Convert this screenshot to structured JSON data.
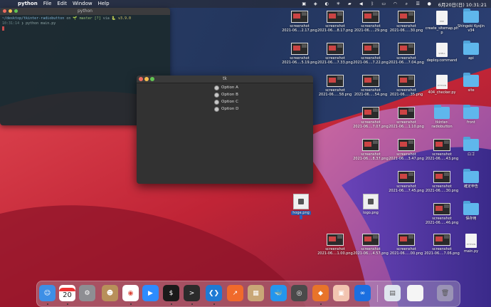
{
  "menubar": {
    "app_name": "python",
    "items": [
      "File",
      "Edit",
      "Window",
      "Help"
    ],
    "clock": "6月20日(日)  10:31:21"
  },
  "terminal": {
    "title": "python",
    "line1_path": "~/desktop/tkinter-radiobutton",
    "line1_on": " on ",
    "line1_git": "🌱 master [?]",
    "line1_via": " via ",
    "line1_py": "🐍 v3.9.0",
    "line2_time": "10:31:14",
    "line2_cmd": " ❯ python main.py"
  },
  "tk": {
    "title": "tk",
    "options": [
      "Option A",
      "Option B",
      "Option C",
      "Option D"
    ]
  },
  "desktop_icons": [
    {
      "label1": "screenshot",
      "label2": "2021-06....2.17.png",
      "kind": "shot"
    },
    {
      "label1": "screenshot",
      "label2": "2021-06....8.17.png",
      "kind": "shot"
    },
    {
      "label1": "screenshot",
      "label2": "2021-06.....29.png",
      "kind": "shot"
    },
    {
      "label1": "screenshot",
      "label2": "2021-06.....30.png",
      "kind": "shot"
    },
    {
      "label1": "create_sitemap.ph",
      "label2": "p",
      "kind": "doc",
      "tag": "PHP"
    },
    {
      "label1": "Shingeki Kyojin",
      "label2": "v34",
      "kind": "folder"
    },
    {
      "label1": "screenshot",
      "label2": "2021-06....5.19.png",
      "kind": "shot"
    },
    {
      "label1": "screenshot",
      "label2": "2021-06....7.33.png",
      "kind": "shot"
    },
    {
      "label1": "screenshot",
      "label2": "2021-06....7.22.png",
      "kind": "shot"
    },
    {
      "label1": "screenshot",
      "label2": "2021-06....7.04.png",
      "kind": "shot"
    },
    {
      "label1": "deploy.command",
      "label2": "",
      "kind": "doc",
      "tag": "SHELL"
    },
    {
      "label1": "api",
      "label2": "",
      "kind": "folder"
    },
    {
      "label1": "screenshot",
      "label2": "2021-06.....58.png",
      "kind": "shot"
    },
    {
      "label1": "screenshot",
      "label2": "2021-06.....54.png",
      "kind": "shot"
    },
    {
      "label1": "screenshot",
      "label2": "2021-06.....35.png",
      "kind": "shot"
    },
    {
      "label1": "404_checker.py",
      "label2": "",
      "kind": "doc",
      "tag": "PYTHON"
    },
    {
      "label1": "site",
      "label2": "",
      "kind": "folder"
    },
    {
      "label1": "screenshot",
      "label2": "2021-06....7.07.png",
      "kind": "shot"
    },
    {
      "label1": "screenshot",
      "label2": "2021-06....1.10.png",
      "kind": "shot"
    },
    {
      "label1": "tkinter-",
      "label2": "radiobutton",
      "kind": "folder"
    },
    {
      "label1": "front",
      "label2": "",
      "kind": "folder"
    },
    {
      "label1": "screenshot",
      "label2": "2021-06....8.37.png",
      "kind": "shot"
    },
    {
      "label1": "screenshot",
      "label2": "2021-06....3.47.png",
      "kind": "shot"
    },
    {
      "label1": "screenshot",
      "label2": "2021-06.....43.png",
      "kind": "shot"
    },
    {
      "label1": "ロゴ",
      "label2": "",
      "kind": "folder"
    },
    {
      "label1": "screenshot",
      "label2": "2021-06....7.45.png",
      "kind": "shot"
    },
    {
      "label1": "screenshot",
      "label2": "2021-06.....30.png",
      "kind": "shot"
    },
    {
      "label1": "確定申告",
      "label2": "",
      "kind": "folder"
    },
    {
      "label1": "hoge.png",
      "label2": "",
      "kind": "img",
      "selected": true
    },
    {
      "label1": "logo.png",
      "label2": "",
      "kind": "img"
    },
    {
      "label1": "screenshot",
      "label2": "2021-06.....46.png",
      "kind": "shot"
    },
    {
      "label1": "保存用",
      "label2": "",
      "kind": "folder"
    },
    {
      "label1": "screenshot",
      "label2": "2021-06....1.00.png",
      "kind": "shot"
    },
    {
      "label1": "screenshot",
      "label2": "2021-06....4.57.png",
      "kind": "shot"
    },
    {
      "label1": "screenshot",
      "label2": "2021-06.....00.png",
      "kind": "shot"
    },
    {
      "label1": "screenshot",
      "label2": "2021-06....7.06.png",
      "kind": "shot"
    },
    {
      "label1": "main.py",
      "label2": "",
      "kind": "doc",
      "tag": "PYTHON"
    }
  ],
  "dock": {
    "calendar_day": "20",
    "apps": [
      {
        "name": "finder-icon",
        "color": "#3d8fe6",
        "glyph": "☺"
      },
      {
        "name": "calendar-icon",
        "color": "#ffffff",
        "glyph": ""
      },
      {
        "name": "system-preferences-icon",
        "color": "#8e8e93",
        "glyph": "⚙"
      },
      {
        "name": "contacts-icon",
        "color": "#b8905a",
        "glyph": "☻"
      },
      {
        "name": "chrome-icon",
        "color": "#ffffff",
        "glyph": "◉"
      },
      {
        "name": "zoom-icon",
        "color": "#2d8cff",
        "glyph": "▶"
      },
      {
        "name": "iterm-icon",
        "color": "#1a1a1a",
        "glyph": "$"
      },
      {
        "name": "terminal-icon",
        "color": "#2b2b2b",
        "glyph": ">"
      },
      {
        "name": "vscode-icon",
        "color": "#1f7ad4",
        "glyph": "❮❯"
      },
      {
        "name": "activity-icon",
        "color": "#f06a2b",
        "glyph": "↗"
      },
      {
        "name": "archive-icon",
        "color": "#c9a777",
        "glyph": "▦"
      },
      {
        "name": "docker-icon",
        "color": "#2496ed",
        "glyph": "🐳"
      },
      {
        "name": "quicktime-icon",
        "color": "#4a4a4a",
        "glyph": "◎"
      },
      {
        "name": "sourcetree-icon",
        "color": "#e8742a",
        "glyph": "◆"
      },
      {
        "name": "preview-icon",
        "color": "#f2c4b0",
        "glyph": "▣"
      },
      {
        "name": "infinity-icon",
        "color": "#1b6fe0",
        "glyph": "∞"
      }
    ]
  }
}
